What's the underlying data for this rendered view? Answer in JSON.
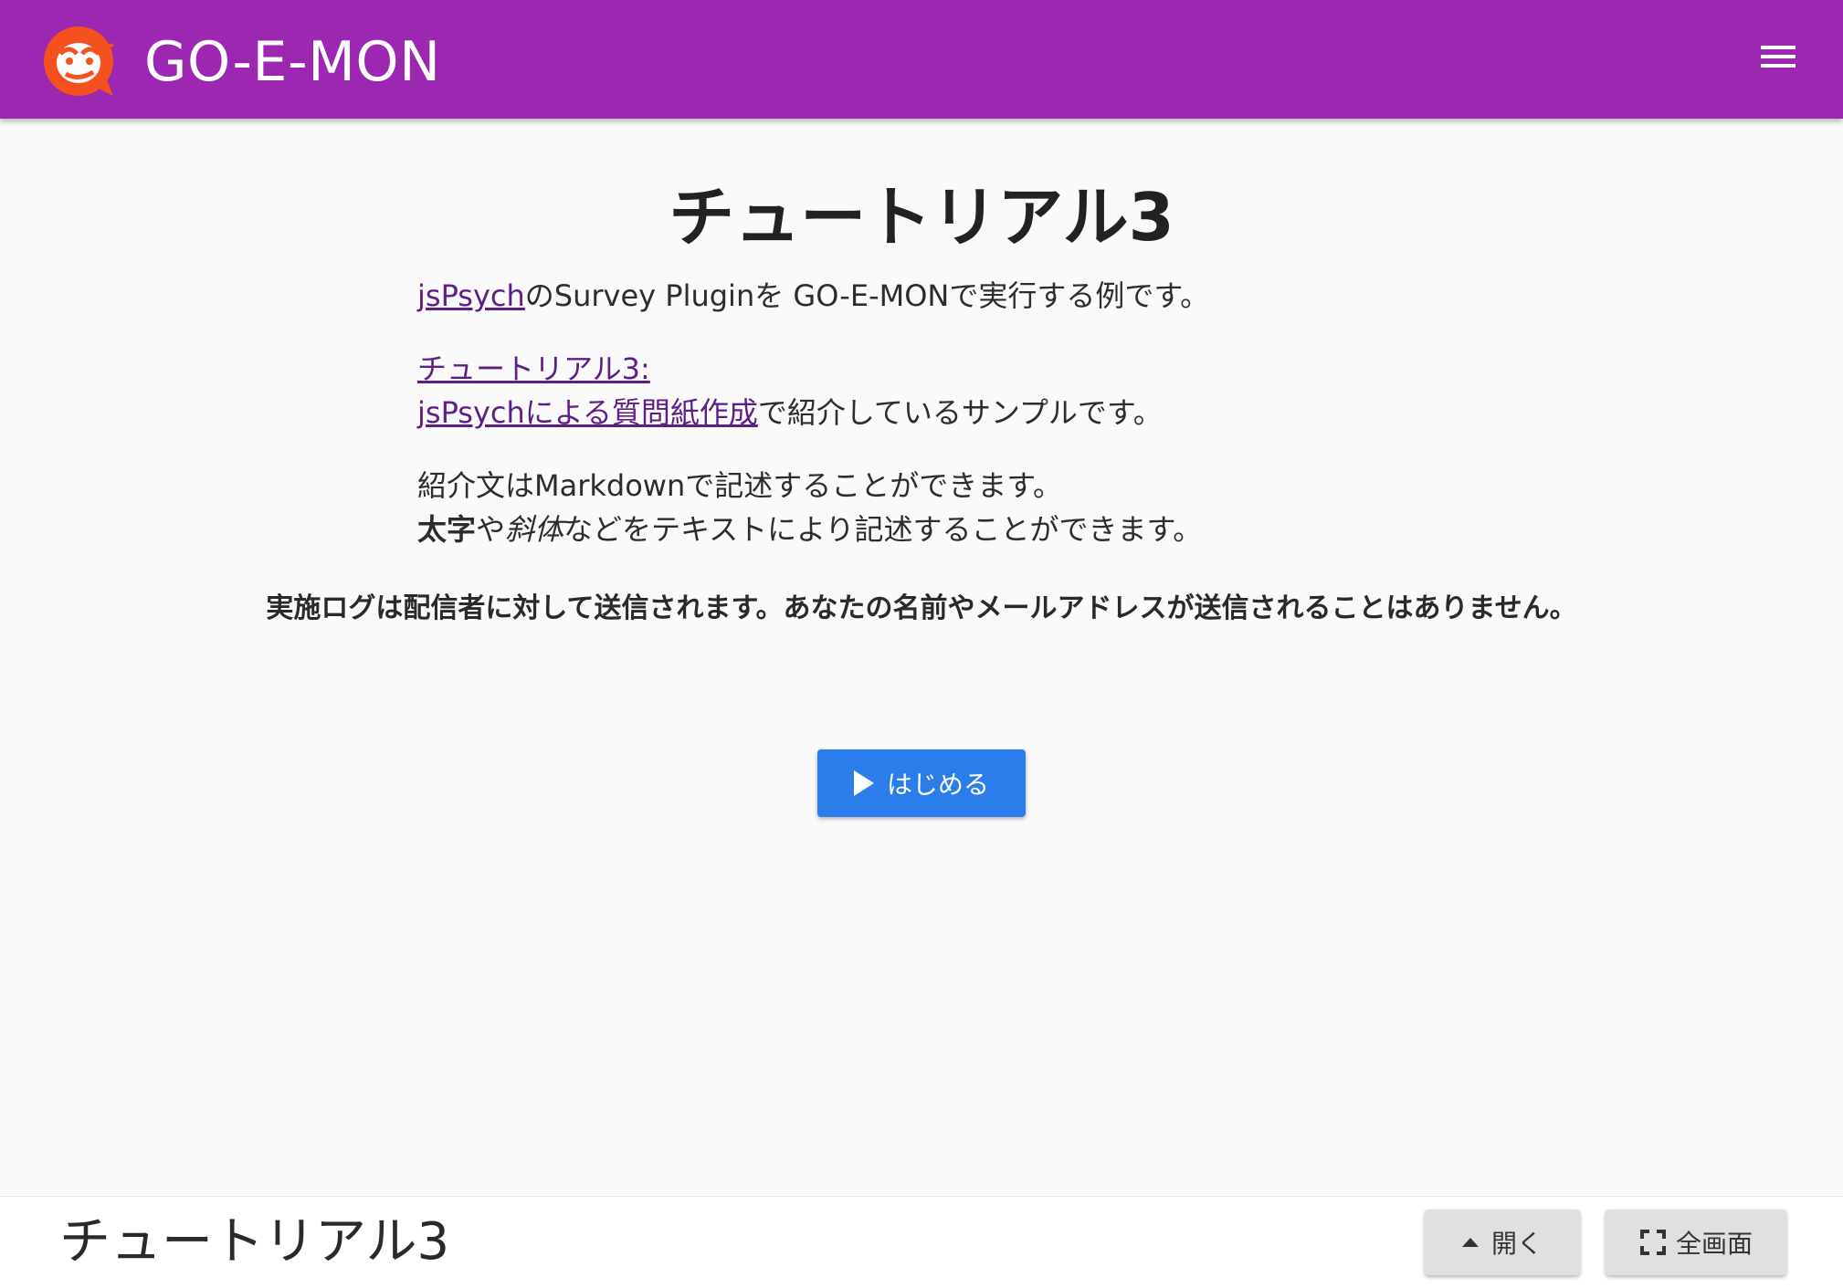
{
  "appbar": {
    "title": "GO-E-MON",
    "logo_icon": "go-e-mon-mascot-icon",
    "menu_icon": "hamburger-menu-icon",
    "color": "#9c27b0"
  },
  "main": {
    "title": "チュートリアル3",
    "intro": {
      "link": "jsPsych",
      "text": "のSurvey Pluginを GO-E-MONで実行する例です。"
    },
    "tutorial": {
      "link_line1": "チュートリアル3:",
      "link_line2": "jsPsychによる質問紙作成",
      "text": "で紹介しているサンプルです。"
    },
    "markdown_line": "紹介文はMarkdownで記述することができます。",
    "format_line": {
      "bold": "太字",
      "mid": "や",
      "italic": "斜体",
      "rest": "などをテキストにより記述することができます。"
    },
    "notice": "実施ログは配信者に対して送信されます。あなたの名前やメールアドレスが送信されることはありません。",
    "start_button": {
      "label": "はじめる",
      "icon": "play-icon",
      "color": "#2b7de9"
    }
  },
  "footer": {
    "title": "チュートリアル3",
    "open_button": {
      "label": "開く",
      "icon": "caret-up-icon"
    },
    "fullscreen_button": {
      "label": "全画面",
      "icon": "fullscreen-icon"
    }
  }
}
